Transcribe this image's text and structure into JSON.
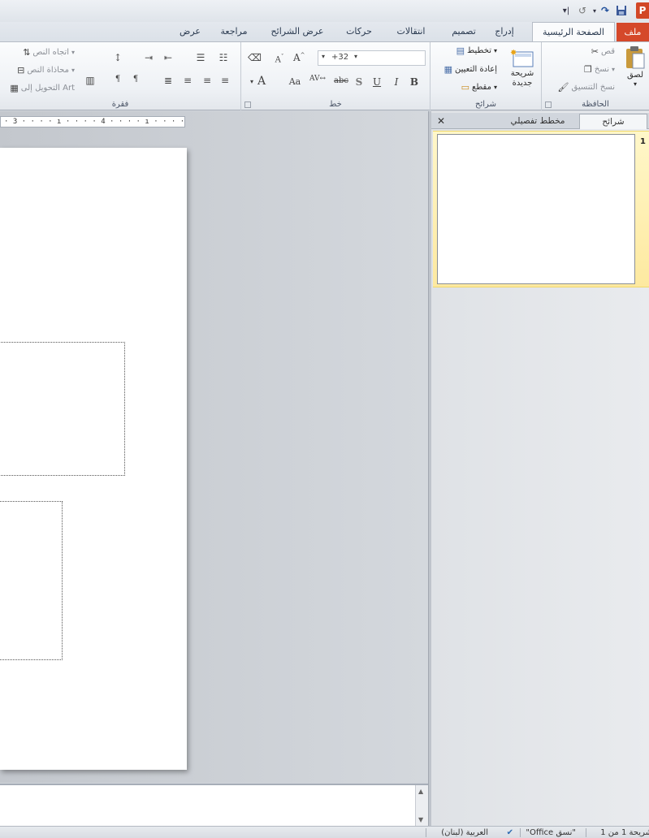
{
  "app": {
    "logo_letter": "P"
  },
  "qat": {
    "save_icon": "save-icon",
    "undo_icon": "undo-icon",
    "redo_icon": "redo-icon",
    "customize_icon": "customize-qat-icon"
  },
  "tabs": [
    {
      "id": "file",
      "label": "ملف"
    },
    {
      "id": "home",
      "label": "الصفحة الرئيسية"
    },
    {
      "id": "insert",
      "label": "إدراج"
    },
    {
      "id": "design",
      "label": "تصميم"
    },
    {
      "id": "transitions",
      "label": "انتقالات"
    },
    {
      "id": "animations",
      "label": "حركات"
    },
    {
      "id": "slideshow",
      "label": "عرض الشرائح"
    },
    {
      "id": "review",
      "label": "مراجعة"
    },
    {
      "id": "view",
      "label": "عرض"
    }
  ],
  "ribbon": {
    "clipboard": {
      "label": "الحافظة",
      "paste": "لصق",
      "cut": "قص",
      "copy": "نسخ",
      "format_painter": "نسخ التنسيق"
    },
    "slides": {
      "label": "شرائح",
      "new_slide_line1": "شريحة",
      "new_slide_line2": "جديدة",
      "layout": "تخطيط",
      "reset": "إعادة التعيين",
      "section": "مقطع"
    },
    "font": {
      "label": "خط",
      "font_size": "+32"
    },
    "paragraph": {
      "label": "فقرة",
      "text_direction": "اتجاه النص",
      "align_text": "محاذاة النص",
      "convert_smartart": "التحويل إلى Art"
    }
  },
  "ruler": {
    "text": "· 3 · · · · ı · · · · 4 · · · · ı · · · ·"
  },
  "pane": {
    "tab_slides": "شرائح",
    "tab_outline": "مخطط تفصيلي",
    "close": "✕",
    "slide_number": "1"
  },
  "status": {
    "slide_info": "شريحة 1 من 1",
    "theme": "\"Office نسق\"",
    "language": "العربية (لبنان)"
  }
}
